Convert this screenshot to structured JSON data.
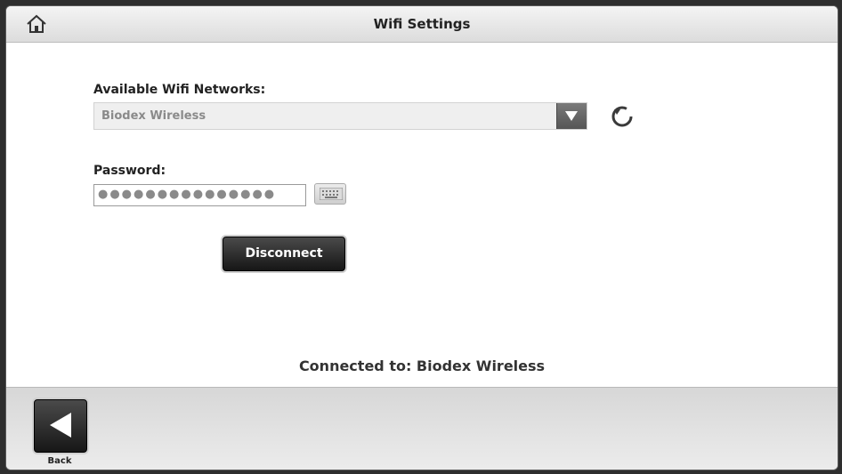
{
  "header": {
    "title": "Wifi Settings",
    "home_icon": "home-icon"
  },
  "wifi": {
    "label": "Available Wifi Networks:",
    "selected_network": "Biodex Wireless",
    "dropdown_icon": "chevron-down-icon",
    "refresh_icon": "refresh-icon"
  },
  "password": {
    "label": "Password:",
    "masked_value": "●●●●●●●●●●●●●●●",
    "keyboard_icon": "keyboard-icon"
  },
  "actions": {
    "disconnect_label": "Disconnect"
  },
  "status": {
    "text": "Connected to: Biodex Wireless"
  },
  "footer": {
    "back_label": "Back",
    "back_icon": "arrow-left-icon"
  },
  "colors": {
    "button_dark": "#1f1f1f",
    "background": "#ffffff",
    "frame": "#2e2e2e"
  }
}
